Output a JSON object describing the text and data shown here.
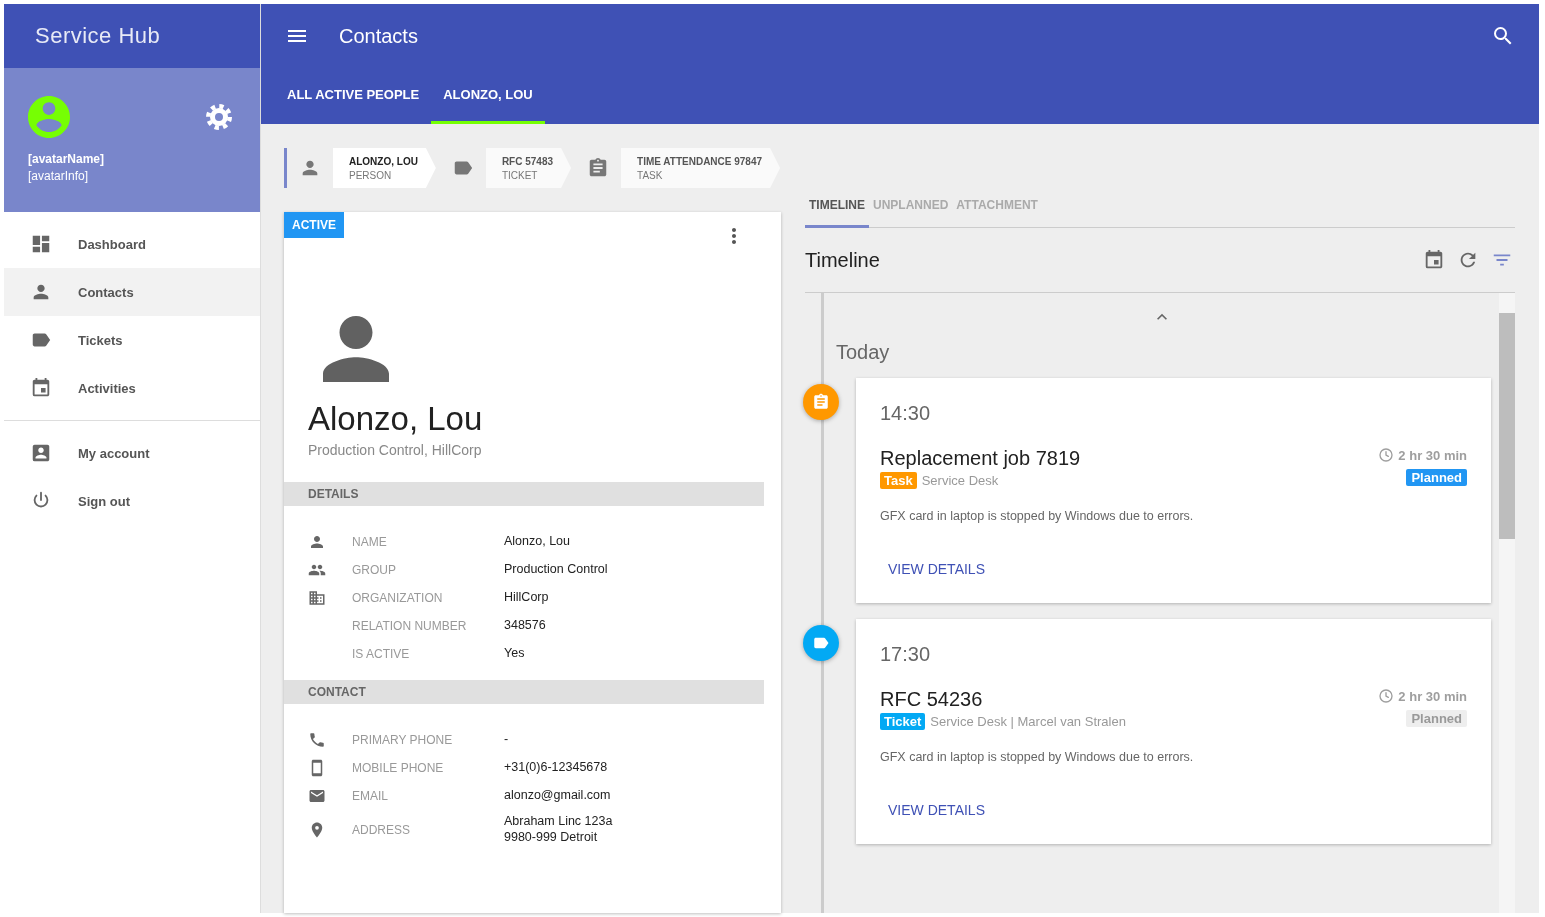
{
  "app": {
    "title": "Service Hub"
  },
  "profile": {
    "name": "[avatarName]",
    "info": "[avatarInfo]"
  },
  "nav": {
    "groups": [
      [
        {
          "kind": "dashboard",
          "label": "Dashboard",
          "selected": false
        },
        {
          "kind": "person",
          "label": "Contacts",
          "selected": true
        },
        {
          "kind": "label",
          "label": "Tickets",
          "selected": false
        },
        {
          "kind": "event",
          "label": "Activities",
          "selected": false
        }
      ],
      [
        {
          "kind": "accountbox",
          "label": "My account",
          "selected": false
        },
        {
          "kind": "power",
          "label": "Sign out",
          "selected": false
        }
      ]
    ]
  },
  "header": {
    "title": "Contacts"
  },
  "tabs": [
    {
      "label": "ALL ACTIVE PEOPLE",
      "selected": false
    },
    {
      "label": "ALONZO, LOU",
      "selected": true
    }
  ],
  "breadcrumbs": [
    {
      "kind": "person",
      "title": "ALONZO, LOU",
      "subtitle": "PERSON",
      "selected": true
    },
    {
      "kind": "label",
      "title": "RFC 57483",
      "subtitle": "TICKET",
      "selected": false
    },
    {
      "kind": "assignment",
      "title": "TIME ATTENDANCE 97847",
      "subtitle": "TASK",
      "selected": false
    }
  ],
  "contact": {
    "status": "ACTIVE",
    "name": "Alonzo, Lou",
    "subtitle": "Production Control, HillCorp",
    "sections": [
      {
        "title": "DETAILS",
        "rows": [
          {
            "kind": "person",
            "label": "NAME",
            "value": "Alonzo, Lou"
          },
          {
            "kind": "group",
            "label": "GROUP",
            "value": "Production Control"
          },
          {
            "kind": "business",
            "label": "ORGANIZATION",
            "value": "HillCorp"
          },
          {
            "label": "RELATION NUMBER",
            "value": "348576"
          },
          {
            "label": "IS ACTIVE",
            "value": "Yes"
          }
        ]
      },
      {
        "title": "CONTACT",
        "rows": [
          {
            "kind": "phone",
            "label": "PRIMARY PHONE",
            "value": "-"
          },
          {
            "kind": "smartphone",
            "label": "MOBILE PHONE",
            "value": "+31(0)6-12345678"
          },
          {
            "kind": "email",
            "label": "EMAIL",
            "value": "alonzo@gmail.com"
          },
          {
            "kind": "place",
            "label": "ADDRESS",
            "value": "Abraham Linc 123a\n9980-999 Detroit"
          }
        ]
      }
    ]
  },
  "timeline": {
    "tabs": [
      {
        "label": "TIMELINE",
        "selected": true
      },
      {
        "label": "UNPLANNED",
        "selected": false
      },
      {
        "label": "ATTACHMENT",
        "selected": false
      }
    ],
    "title": "Timeline",
    "day": "Today",
    "events": [
      {
        "kind": "task",
        "color": "#ff9800",
        "time": "14:30",
        "title": "Replacement job 7819",
        "tag": "Task",
        "meta": "Service Desk",
        "duration": "2 hr 30 min",
        "status": "Planned",
        "highlighted": true,
        "description": "GFX card in laptop is stopped by Windows due to errors.",
        "action": "VIEW DETAILS"
      },
      {
        "kind": "ticket",
        "color": "#03a9f4",
        "time": "17:30",
        "title": "RFC 54236",
        "tag": "Ticket",
        "meta": "Service Desk | Marcel van Stralen",
        "duration": "2 hr 30 min",
        "status": "Planned",
        "highlighted": false,
        "description": "GFX card in laptop is stopped by Windows due to errors.",
        "action": "VIEW DETAILS"
      }
    ]
  }
}
